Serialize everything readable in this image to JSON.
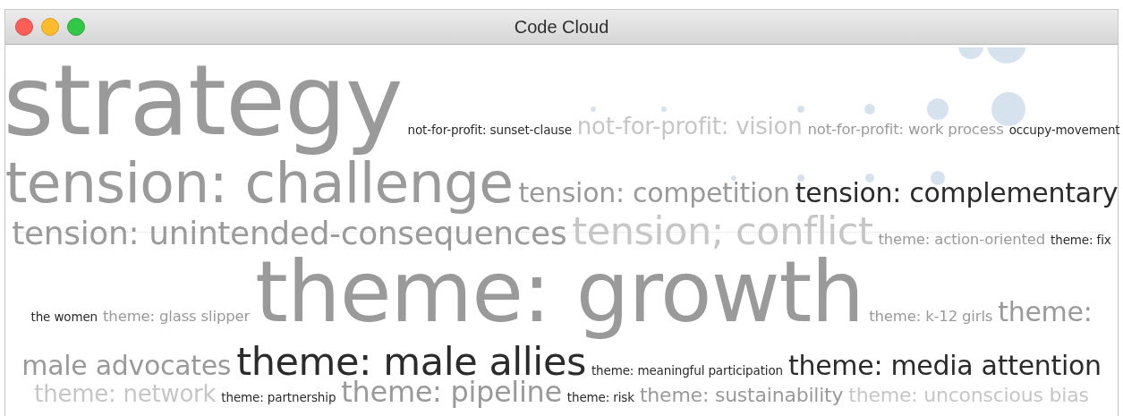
{
  "window": {
    "title": "Code Cloud"
  },
  "rows": [
    {
      "words": [
        {
          "text": "strategy",
          "kind": "colossal",
          "color": "#9a9a9a"
        },
        {
          "text": "not-for-profit: sunset-clause",
          "kind": "tiny",
          "color": "#2b2b2b"
        },
        {
          "text": "not-for-profit: vision",
          "kind": "sizable",
          "color": "#c6c6c6"
        },
        {
          "text": "not-for-profit: work process",
          "kind": "small",
          "color": "#9a9a9a"
        },
        {
          "text": "occupy-movement",
          "kind": "tiny",
          "color": "#2b2b2b"
        }
      ]
    },
    {
      "words": [
        {
          "text": "tension: challenge",
          "kind": "huge",
          "color": "#9a9a9a"
        },
        {
          "text": "tension: competition",
          "kind": "large",
          "color": "#9a9a9a"
        },
        {
          "text": "tension: complementary",
          "kind": "large",
          "color": "#2b2b2b"
        }
      ]
    },
    {
      "words": [
        {
          "text": "tension: unintended-consequences",
          "kind": "bigger",
          "color": "#9a9a9a"
        },
        {
          "text": "tension; conflict",
          "kind": "big",
          "color": "#c6c6c6"
        },
        {
          "text": "theme: action-oriented",
          "kind": "small",
          "color": "#9a9a9a"
        },
        {
          "text": "theme: fix",
          "kind": "tiny",
          "color": "#2b2b2b"
        }
      ]
    },
    {
      "words": [
        {
          "text": "the women",
          "kind": "tiny",
          "color": "#2b2b2b"
        },
        {
          "text": "theme: glass slipper",
          "kind": "small",
          "color": "#9a9a9a"
        },
        {
          "text": "theme: growth",
          "kind": "giant",
          "color": "#9a9a9a"
        },
        {
          "text": "theme: k-12 girls",
          "kind": "small",
          "color": "#9a9a9a"
        },
        {
          "text": "theme:",
          "kind": "large",
          "color": "#9a9a9a"
        }
      ]
    },
    {
      "words": [
        {
          "text": "male advocates",
          "kind": "large",
          "color": "#9a9a9a"
        },
        {
          "text": "theme: male allies",
          "kind": "big",
          "color": "#2b2b2b"
        },
        {
          "text": "theme: meaningful participation",
          "kind": "tiny",
          "color": "#2b2b2b"
        },
        {
          "text": "theme: media attention",
          "kind": "large",
          "color": "#2b2b2b"
        }
      ]
    },
    {
      "words": [
        {
          "text": "theme: network",
          "kind": "sizable",
          "color": "#c6c6c6"
        },
        {
          "text": "theme: partnership",
          "kind": "tiny",
          "color": "#2b2b2b"
        },
        {
          "text": "theme: pipeline",
          "kind": "larger",
          "color": "#9a9a9a"
        },
        {
          "text": "theme: risk",
          "kind": "tiny",
          "color": "#2b2b2b"
        },
        {
          "text": "theme: sustainability",
          "kind": "medium",
          "color": "#9a9a9a"
        },
        {
          "text": "theme: unconscious bias",
          "kind": "medium",
          "color": "#c6c6c6"
        }
      ]
    }
  ]
}
